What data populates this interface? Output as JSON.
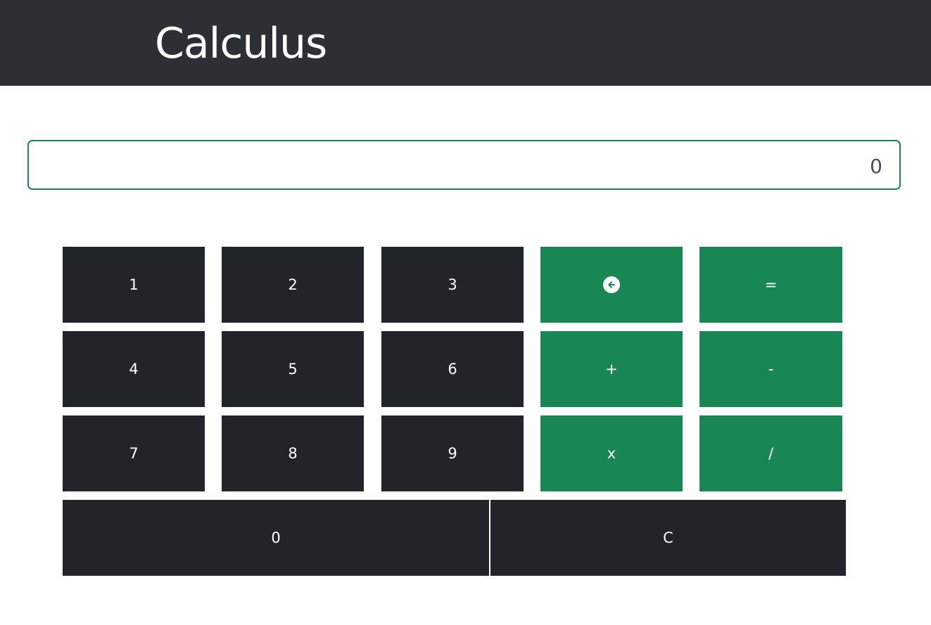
{
  "header": {
    "title": "Calculus"
  },
  "display": {
    "value": "0"
  },
  "keys": {
    "k1": "1",
    "k2": "2",
    "k3": "3",
    "k4": "4",
    "k5": "5",
    "k6": "6",
    "k7": "7",
    "k8": "8",
    "k9": "9",
    "k0": "0",
    "clear": "C",
    "equals": "=",
    "plus": "+",
    "minus": "-",
    "multiply": "x",
    "divide": "/",
    "backspace_icon": "arrow-left-circle-icon"
  },
  "colors": {
    "header_bg": "#2c3034",
    "key_dark": "#212529",
    "key_green": "#198754",
    "display_border": "#198754"
  }
}
